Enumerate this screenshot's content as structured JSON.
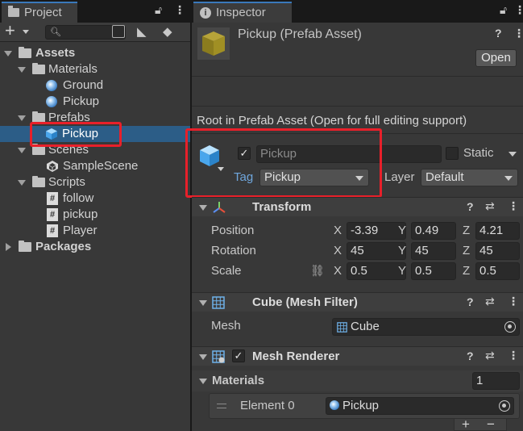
{
  "project": {
    "tab_label": "Project",
    "add_label": "+",
    "tree": {
      "assets": "Assets",
      "materials": "Materials",
      "ground": "Ground",
      "pickup_mat": "Pickup",
      "prefabs": "Prefabs",
      "pickup_prefab": "Pickup",
      "scenes": "Scenes",
      "samplescene": "SampleScene",
      "scripts": "Scripts",
      "follow": "follow",
      "pickup_script": "pickup",
      "player": "Player",
      "packages": "Packages"
    }
  },
  "inspector": {
    "tab_label": "Inspector",
    "asset_title": "Pickup (Prefab Asset)",
    "open_button": "Open",
    "root_notice": "Root in Prefab Asset (Open for full editing support)",
    "name_value": "Pickup",
    "static_label": "Static",
    "tag_label": "Tag",
    "tag_value": "Pickup",
    "layer_label": "Layer",
    "layer_value": "Default",
    "transform": {
      "title": "Transform",
      "position_label": "Position",
      "rotation_label": "Rotation",
      "scale_label": "Scale",
      "x": "X",
      "y": "Y",
      "z": "Z",
      "position": [
        "-3.39",
        "0.49",
        "4.21"
      ],
      "rotation": [
        "45",
        "45",
        "45"
      ],
      "scale": [
        "0.5",
        "0.5",
        "0.5"
      ]
    },
    "mesh_filter": {
      "title": "Cube (Mesh Filter)",
      "mesh_label": "Mesh",
      "mesh_value": "Cube"
    },
    "mesh_renderer": {
      "title": "Mesh Renderer",
      "materials_label": "Materials",
      "materials_count": "1",
      "element_label": "Element 0",
      "element_value": "Pickup",
      "add_label": "+",
      "remove_label": "−"
    }
  },
  "colors": {
    "selection": "#2c5d87",
    "highlight_box": "#e8202a",
    "accent_tab": "#3a79bb"
  }
}
